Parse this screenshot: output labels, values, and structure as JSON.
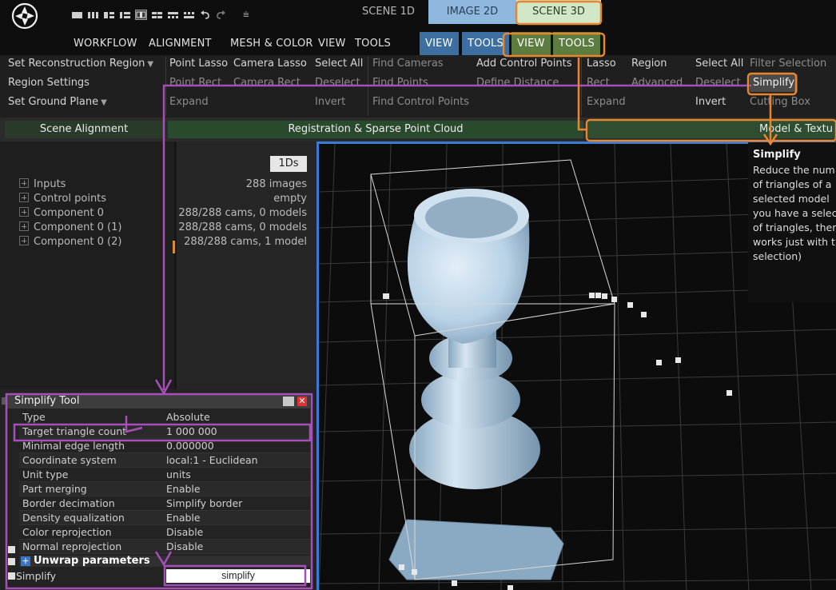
{
  "topbar": {
    "logo": "app-logo",
    "quick_access_more": "⩧",
    "scene_tabs": [
      "SCENE 1D",
      "IMAGE 2D",
      "SCENE 3D"
    ]
  },
  "menu": [
    "WORKFLOW",
    "ALIGNMENT",
    "MESH & COLOR",
    "VIEW",
    "TOOLS",
    "VIEW",
    "TOOLS",
    "VIEW",
    "TOOLS"
  ],
  "ribbon": {
    "alignment": {
      "set_reconstruction_region": "Set Reconstruction Region",
      "region_settings": "Region Settings",
      "set_ground_plane": "Set Ground Plane"
    },
    "registration_tools": {
      "point_lasso": "Point Lasso",
      "camera_lasso": "Camera Lasso",
      "select_all": "Select All",
      "point_rect": "Point Rect",
      "camera_rect": "Camera Rect",
      "deselect": "Deselect",
      "expand": "Expand",
      "invert": "Invert",
      "find_cameras": "Find Cameras",
      "find_points": "Find Points",
      "find_control_points": "Find Control Points",
      "add_control_points": "Add Control Points",
      "define_distance": "Define Distance"
    },
    "model_tools": {
      "lasso": "Lasso",
      "region": "Region",
      "select_all": "Select All",
      "filter_selection": "Filter Selection",
      "rect": "Rect",
      "advanced": "Advanced",
      "deselect": "Deselect",
      "simplify": "Simplify",
      "expand": "Expand",
      "invert": "Invert",
      "cutting_box": "Cutting Box"
    },
    "groups": {
      "scene_alignment": "Scene Alignment",
      "registration": "Registration & Sparse Point Cloud",
      "model_texture": "Model & Textu"
    }
  },
  "tree": {
    "items": [
      "Inputs",
      "Control points",
      "Component 0",
      "Component 0 (1)",
      "Component 0 (2)"
    ]
  },
  "info": {
    "badge": "1Ds",
    "values": [
      "288 images",
      "empty",
      "288/288 cams, 0 models",
      "288/288 cams, 0 models",
      "288/288 cams, 1 model"
    ]
  },
  "tool": {
    "title": "Simplify Tool",
    "close": "✕",
    "properties": [
      {
        "name": "Type",
        "value": "Absolute"
      },
      {
        "name": "Target triangle count",
        "value": "1 000 000"
      },
      {
        "name": "Minimal edge length",
        "value": "0.000000"
      },
      {
        "name": "Coordinate system",
        "value": "local:1 - Euclidean"
      },
      {
        "name": "Unit type",
        "value": "units"
      },
      {
        "name": "Part merging",
        "value": "Enable"
      },
      {
        "name": "Border decimation",
        "value": "Simplify border"
      },
      {
        "name": "Density equalization",
        "value": "Enable"
      },
      {
        "name": "Color reprojection",
        "value": "Disable"
      },
      {
        "name": "Normal reprojection",
        "value": "Disable"
      }
    ],
    "unwrap_label": "Unwrap parameters",
    "unwrap_plus": "+",
    "simplify_name": "Simplify",
    "simplify_button": "simplify"
  },
  "tooltip": {
    "title": "Simplify",
    "lines": [
      "Reduce the num",
      "of triangles of a",
      "selected model",
      "you have a selec",
      "of triangles, ther",
      "works just with t",
      "selection)"
    ]
  },
  "colors": {
    "annotation_purple": "#a64fb8",
    "annotation_orange": "#e8862d",
    "viewport_border": "#3a7bd5",
    "model": "#b9d2e6"
  }
}
